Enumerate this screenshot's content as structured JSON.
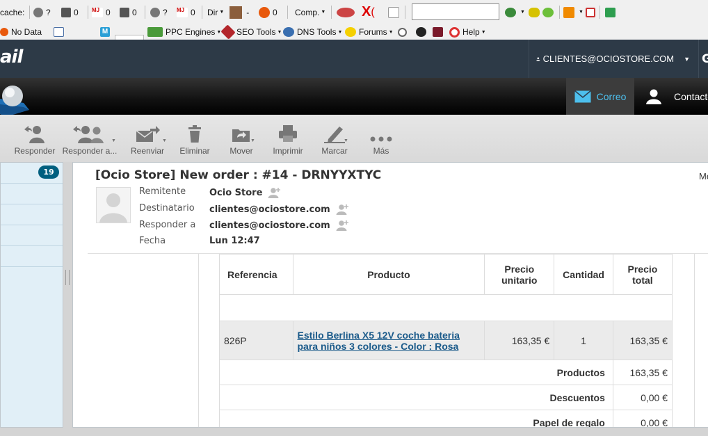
{
  "browser_toolbar": {
    "row1": {
      "cache_label": "cache:",
      "items": [
        {
          "icon": "google-pagerank-icon",
          "value": "?"
        },
        {
          "icon": "alexa-rank-icon",
          "value": "0"
        },
        {
          "icon": "majestic-seo-icon",
          "value": "0"
        },
        {
          "icon": "alexa-rank-icon",
          "value": "0"
        },
        {
          "icon": "google-pagerank-icon",
          "value": "?"
        },
        {
          "icon": "majestic-seo-icon",
          "value": "0"
        }
      ],
      "dir_label": "Dir",
      "dir_value": "-",
      "compete_value": "0",
      "comp_label": "Comp.",
      "search_value": ""
    },
    "row2": {
      "no_data_label": "No Data",
      "ppc_label": "PPC Engines",
      "seo_label": "SEO Tools",
      "dns_label": "DNS Tools",
      "forums_label": "Forums",
      "help_label": "Help"
    }
  },
  "app": {
    "logo_text": "ail",
    "user_label": "CLIENTES@OCIOSTORE.COM",
    "next_truncated": "G",
    "nav": {
      "mail_label": "Correo",
      "contacts_label": "Contacto"
    }
  },
  "toolbar": {
    "buttons": [
      {
        "label": "Responder",
        "icon": "reply-icon"
      },
      {
        "label": "Responder a...",
        "icon": "reply-all-icon"
      },
      {
        "label": "Reenviar",
        "icon": "forward-icon"
      },
      {
        "label": "Eliminar",
        "icon": "trash-icon"
      },
      {
        "label": "Mover",
        "icon": "folder-move-icon"
      },
      {
        "label": "Imprimir",
        "icon": "printer-icon"
      },
      {
        "label": "Marcar",
        "icon": "pen-mark-icon"
      },
      {
        "label": "Más",
        "icon": "more-dots-icon"
      }
    ]
  },
  "folders": {
    "unread_count": "19"
  },
  "message": {
    "subject": "[Ocio Store] New order : #14 - DRNYYXTYC",
    "more_truncated": "Me",
    "headers": [
      {
        "label": "Remitente",
        "value": "Ocio Store"
      },
      {
        "label": "Destinatario",
        "value": "clientes@ociostore.com"
      },
      {
        "label": "Responder a",
        "value": "clientes@ociostore.com"
      },
      {
        "label": "Fecha",
        "value": "Lun 12:47"
      }
    ],
    "order_table": {
      "columns": [
        "Referencia",
        "Producto",
        "Precio unitario",
        "Cantidad",
        "Precio total"
      ],
      "items": [
        {
          "reference": "826P",
          "product": "Estilo Berlina X5 12V coche bateria para niños 3 colores - Color : Rosa",
          "unit_price": "163,35 €",
          "quantity": "1",
          "total": "163,35 €"
        }
      ],
      "totals": [
        {
          "label": "Productos",
          "value": "163,35 €"
        },
        {
          "label": "Descuentos",
          "value": "0,00 €"
        },
        {
          "label": "Papel de regalo",
          "value": "0,00 €"
        }
      ]
    }
  },
  "colors": {
    "header_bg": "#2d3a47",
    "accent": "#4dbfed",
    "badge": "#005f7f",
    "link": "#1a5a8a"
  }
}
